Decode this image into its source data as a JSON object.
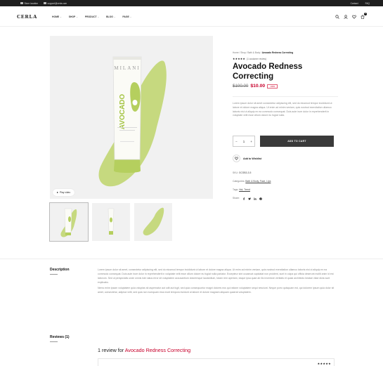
{
  "topbar": {
    "left": [
      {
        "icon": "location-icon",
        "text": "Store location"
      },
      {
        "icon": "mail-icon",
        "text": "support@cerla.com"
      }
    ],
    "right": [
      "Contact",
      "FAQ"
    ]
  },
  "header": {
    "logo": "CERLA",
    "nav": [
      {
        "label": "HOME",
        "has_dropdown": true
      },
      {
        "label": "SHOP",
        "has_dropdown": true
      },
      {
        "label": "PRODUCT",
        "has_dropdown": true
      },
      {
        "label": "BLOG",
        "has_dropdown": true
      },
      {
        "label": "PAGE",
        "has_dropdown": true
      }
    ],
    "icons": [
      "search-icon",
      "user-icon",
      "heart-icon",
      "cart-icon"
    ],
    "cart_count": "0"
  },
  "gallery": {
    "play_label": "Play video",
    "thumbs": [
      "thumb-front",
      "thumb-side",
      "thumb-swatch"
    ],
    "tube_brand": "MILANI",
    "tube_name": "AVOCADO",
    "colors": {
      "green": "#b5cf5e",
      "light_green": "#c9dd84",
      "bg": "#f1f1f1"
    }
  },
  "product": {
    "breadcrumb": {
      "items": [
        "Home",
        "Shop",
        "Bath & Body"
      ],
      "current": "Avocado Redness Correcting"
    },
    "rating_stars": "★★★★★",
    "rating_text": "(1 customer review)",
    "title_line1": "Avocado Redness",
    "title_line2": "Correcting",
    "old_price": "$100.00",
    "new_price": "$10.00",
    "discount": "-90%",
    "short_description": "Lorem ipsum dolor sit amet consectetur adipiscing elit, sed do eiusmod tempor incididunt ut labore et dolore magna aliqua. Ut enim ad minim veniam, quis nostrud exercitation ullamco laboris nisi ut aliquip ex ea commodo consequat. Duis aute irure dolor in reprehenderit in voluptate velit esse cillum dolore eu fugiat nulla.",
    "quantity": "1",
    "qty_minus": "−",
    "qty_plus": "+",
    "add_to_cart": "ADD TO CART",
    "wishlist": "Add to Wishlist",
    "sku_label": "SKU:",
    "sku_value": "GCSB3-3-5",
    "categories_label": "Categories:",
    "categories_value": "Bath & Body, Face, Lips",
    "tags_label": "Tags:",
    "tags_value": "Hot, Trend",
    "share_label": "Share:",
    "share_icons": [
      "facebook-icon",
      "twitter-icon",
      "linkedin-icon",
      "pinterest-icon"
    ]
  },
  "tabs": {
    "description": "Description",
    "reviews": "Reviews (1)"
  },
  "description_text": {
    "p1": "Lorem ipsum dolor sit amet, consectetur adipiscing elit, sed do eiusmod tempor incididunt ut labore et dolore magna aliqua. Ut enim ad minim veniam, quis nostrud exercitation ullamco laboris nisi ut aliquip ex ea commodo consequat. Duis aute irure dolor in reprehenderit in voluptate velit esse cillum dolore eu fugiat nulla pariatur. Excepteur sint occaecat cupidatat non proident, sunt in culpa qui officia deserunt mollit anim id est laborum. Sed ut perspiciatis unde omnis iste natus error sit voluptatem accusantium doloremque laudantium, totam rem aperiam, eaque ipsa quae ab illo inventore veritatis et quasi architecto beatae vitae dicta sunt explicabo.",
    "p2": "Nemo enim ipsam voluptatem quia voluptas sit aspernatur aut odit aut fugit, sed quia consequuntur magni dolores eos qui ratione voluptatem sequi nesciunt. Neque porro quisquam est, qui dolorem ipsum quia dolor sit amet, consectetur, adipisci velit, sed quia non numquam eius modi tempora incidunt ut labore et dolore magnam aliquam quaerat voluptatem."
  },
  "reviews_section": {
    "prefix": "1 review for ",
    "product": "Avocado Redness Correcting",
    "stars": "★★★★★"
  }
}
